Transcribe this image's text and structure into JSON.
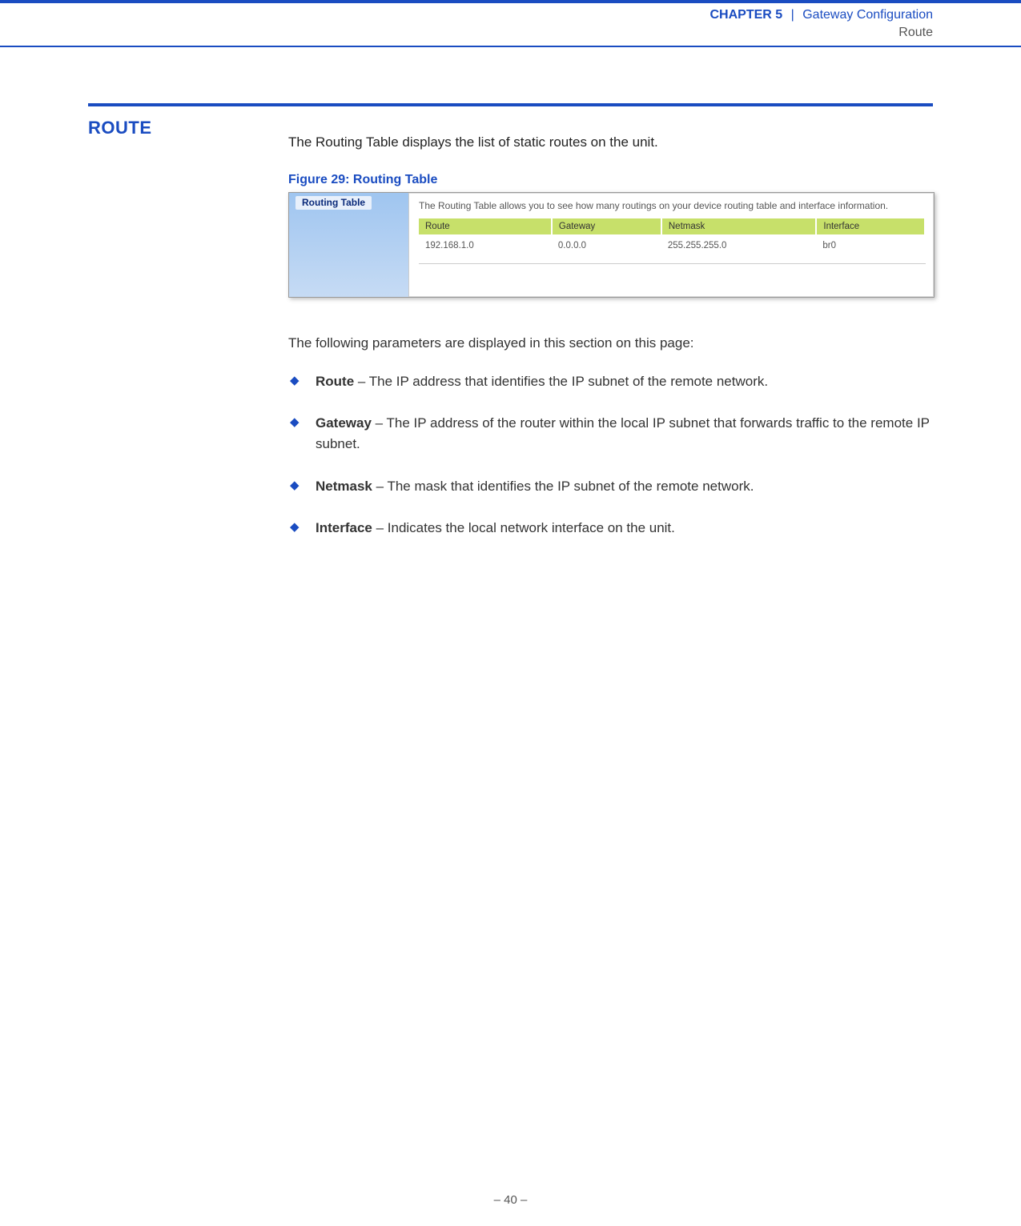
{
  "header": {
    "chapter_label": "CHAPTER 5",
    "separator": "|",
    "chapter_title": "Gateway Configuration",
    "sub": "Route"
  },
  "section": {
    "heading": "ROUTE",
    "intro": "The Routing Table displays the list of static routes on the unit.",
    "figure_caption": "Figure 29:  Routing Table",
    "following": "The following parameters are displayed in this section on this page:",
    "params": [
      {
        "term": "Route",
        "desc": " – The IP address that identifies the IP subnet of the remote network."
      },
      {
        "term": "Gateway",
        "desc": " – The IP address of the router within the local IP subnet that forwards traffic to the remote IP subnet."
      },
      {
        "term": "Netmask",
        "desc": " – The mask that identifies the IP subnet of the remote network."
      },
      {
        "term": "Interface",
        "desc": " – Indicates the local network interface on the unit."
      }
    ]
  },
  "screenshot": {
    "tab_label": "Routing Table",
    "description": "The Routing Table allows you to see how many routings on your device routing table and interface information.",
    "columns": [
      "Route",
      "Gateway",
      "Netmask",
      "Interface"
    ],
    "row": {
      "route": "192.168.1.0",
      "gateway": "0.0.0.0",
      "netmask": "255.255.255.0",
      "iface": "br0"
    }
  },
  "footer": {
    "page": "–  40  –"
  }
}
